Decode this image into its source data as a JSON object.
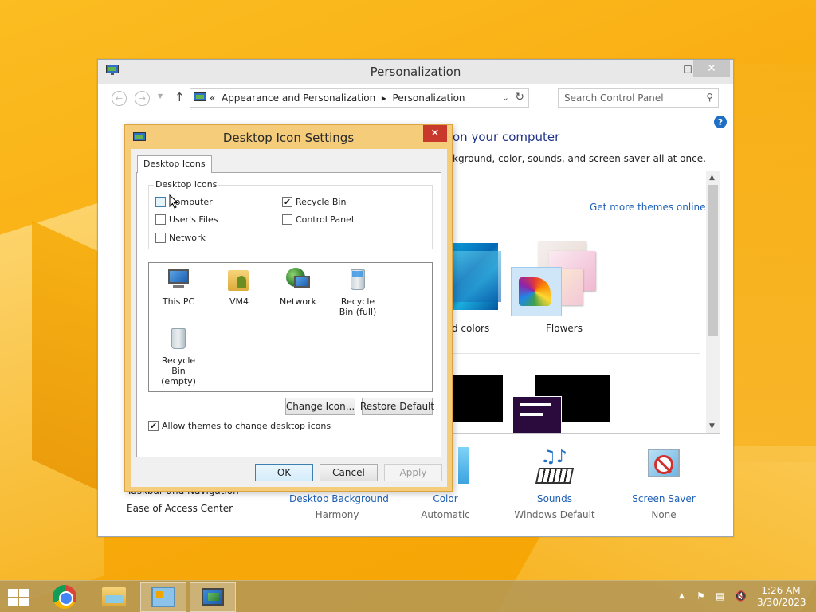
{
  "main_window": {
    "title": "Personalization",
    "min_label": "–",
    "max_label": "□",
    "close_label": "✕",
    "breadcrumb_sep_left": "«",
    "breadcrumb_1": "Appearance and Personalization",
    "breadcrumb_arrow": "▸",
    "breadcrumb_2": "Personalization",
    "search_placeholder": "Search Control Panel",
    "heading_partial": "on your computer",
    "subheading_partial": "kground, color, sounds, and screen saver all at once.",
    "get_more_themes": "Get more themes online",
    "theme_label_partial": "d colors",
    "theme_flowers": "Flowers",
    "left_link_partial": "Taskbar and Navigation",
    "left_link_ease": "Ease of Access Center",
    "bottom": [
      {
        "label": "Desktop Background",
        "value": "Harmony"
      },
      {
        "label": "Color",
        "value": "Automatic"
      },
      {
        "label": "Sounds",
        "value": "Windows Default"
      },
      {
        "label": "Screen Saver",
        "value": "None"
      }
    ],
    "help_label": "?"
  },
  "dialog": {
    "title": "Desktop Icon Settings",
    "close_label": "✕",
    "tab_label": "Desktop Icons",
    "group_label": "Desktop icons",
    "checkboxes": [
      {
        "label": "Computer",
        "checked": false
      },
      {
        "label": "Recycle Bin",
        "checked": true
      },
      {
        "label": "User's Files",
        "checked": false
      },
      {
        "label": "Control Panel",
        "checked": false
      },
      {
        "label": "Network",
        "checked": false
      }
    ],
    "check_mark": "✔",
    "icons": [
      {
        "label": "This PC"
      },
      {
        "label": "VM4"
      },
      {
        "label": "Network"
      },
      {
        "label": "Recycle Bin (full)"
      },
      {
        "label": "Recycle Bin (empty)"
      }
    ],
    "change_icon_label": "Change Icon...",
    "restore_default_label": "Restore Default",
    "allow_themes_label": "Allow themes to change desktop icons",
    "allow_themes_checked": true,
    "ok_label": "OK",
    "cancel_label": "Cancel",
    "apply_label": "Apply"
  },
  "taskbar": {
    "time": "1:26 AM",
    "date": "3/30/2023",
    "tray_chevron": "▲"
  },
  "colors": {
    "accent_link": "#1e5fb5",
    "dialog_frame": "#f5cd7a",
    "close_red": "#c8382b",
    "wallpaper": "#f9ac10"
  }
}
